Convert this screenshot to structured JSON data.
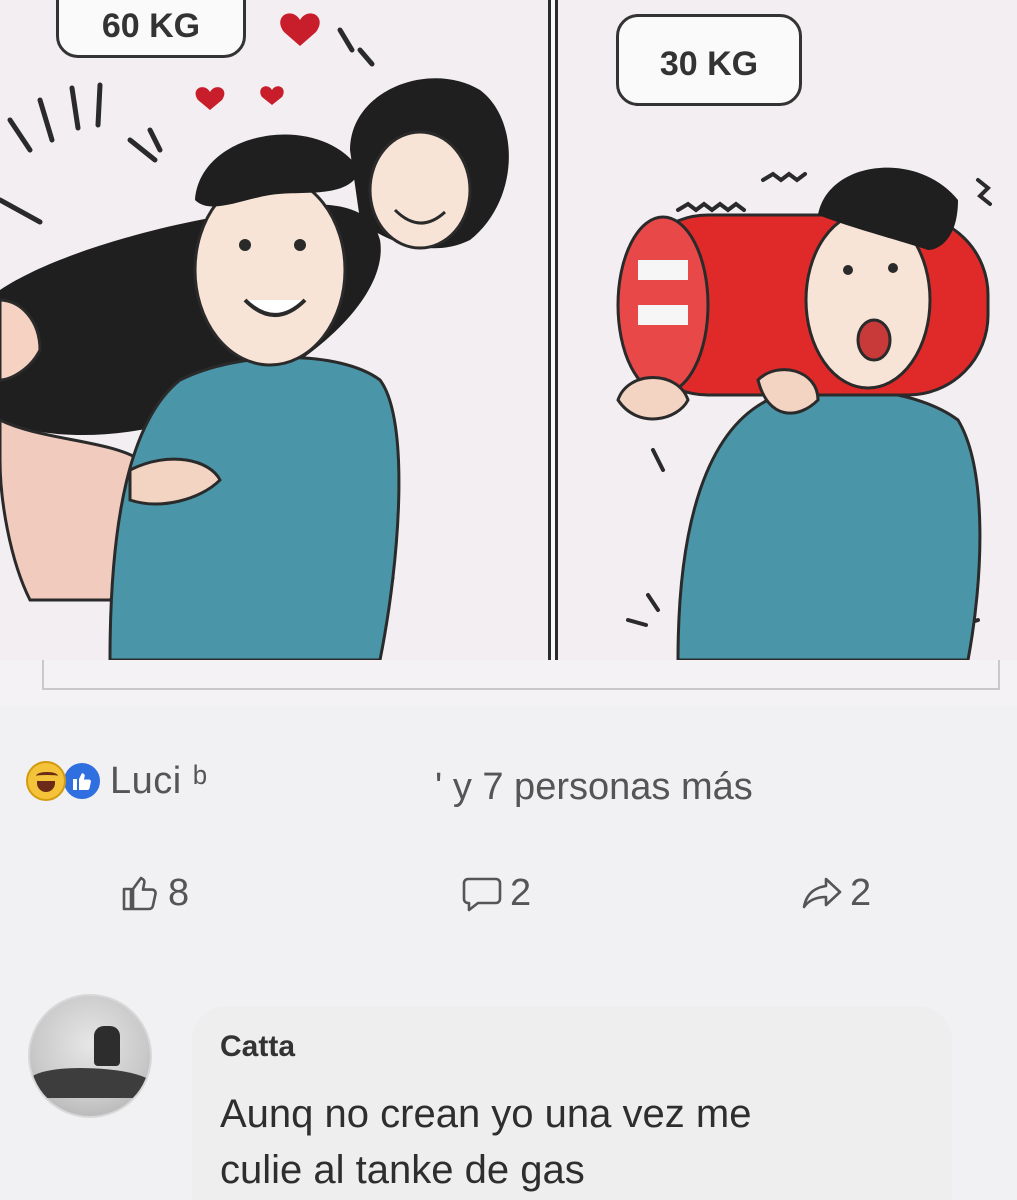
{
  "comic": {
    "left_bubble": "60 KG",
    "right_bubble": "30 KG"
  },
  "reactions": {
    "icons": [
      "laughing-emoji-icon",
      "like-reaction-icon"
    ],
    "names": "Luci ᵇ",
    "more": "' y 7 personas más"
  },
  "actions": {
    "likes": "8",
    "comments": "2",
    "shares": "2"
  },
  "comment": {
    "author": "Catta",
    "text_line1": "Aunq no crean yo una vez me",
    "text_line2": "culie al tanke de gas"
  },
  "colors": {
    "like_blue": "#2f6fe0",
    "emoji_yellow": "#f4c339",
    "shirt_teal": "#4a95a8",
    "tank_red": "#e02a2a"
  }
}
